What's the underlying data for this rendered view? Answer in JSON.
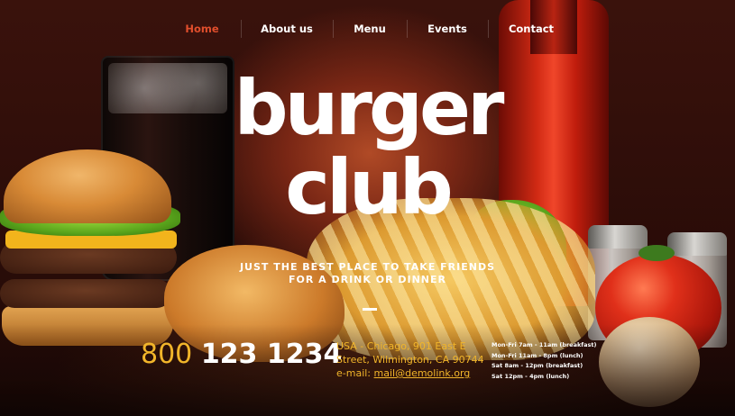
{
  "nav": {
    "items": [
      {
        "label": "Home",
        "active": true
      },
      {
        "label": "About us",
        "active": false
      },
      {
        "label": "Menu",
        "active": false
      },
      {
        "label": "Events",
        "active": false
      },
      {
        "label": "Contact",
        "active": false
      }
    ]
  },
  "hero": {
    "title_line1": "burger",
    "title_line2": "club",
    "tagline_line1": "JUST THE BEST PLACE TO TAKE FRIENDS",
    "tagline_line2": "FOR A DRINK OR DINNER"
  },
  "contact": {
    "phone_prefix": "800",
    "phone_rest": "123 1234",
    "address_line1": "USA - Chicago, 901 East E",
    "address_line2": "Street, Wilmington, CA 90744",
    "email_label": "e-mail: ",
    "email": "mail@demolink.org"
  },
  "hours": [
    "Mon-Fri 7am - 11am (breakfast)",
    "Mon-Fri 11am - 8pm (lunch)",
    "Sat 8am - 12pm (breakfast)",
    "Sat 12pm - 4pm (lunch)"
  ],
  "colors": {
    "accent_active_nav": "#e04e2c",
    "phone_accent": "#f1b52a",
    "text": "#ffffff"
  }
}
